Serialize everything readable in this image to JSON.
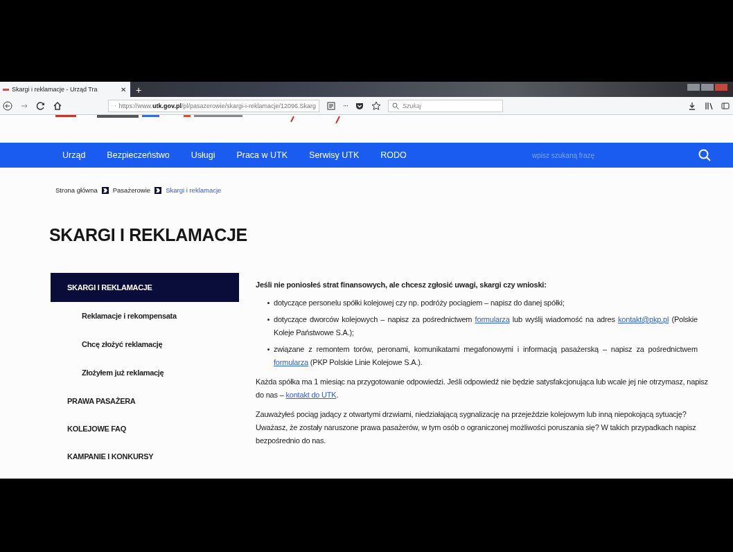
{
  "browser": {
    "tab": {
      "title": "Skargi i reklamacje - Urząd Tra",
      "close": "✕"
    },
    "new_tab": "+",
    "address": "https://www.**utk.gov.pl**/pl/pasazerowie/skargi-i-reklamacje/12096.Skarg",
    "more": "···",
    "search": {
      "placeholder": "Szukaj"
    }
  },
  "nav": {
    "items": [
      {
        "label": "Urząd"
      },
      {
        "label": "Bezpieczeństwo"
      },
      {
        "label": "Usługi"
      },
      {
        "label": "Praca w UTK"
      },
      {
        "label": "Serwisy UTK"
      },
      {
        "label": "RODO"
      }
    ],
    "search": {
      "placeholder": "wpisz szukaną frazę"
    }
  },
  "breadcrumb": [
    {
      "label": "Strona główna",
      "current": false
    },
    {
      "label": "Pasażerowie",
      "current": false
    },
    {
      "label": "Skargi i reklamacje",
      "current": true
    }
  ],
  "title": "SKARGI I REKLAMACJE",
  "sidebar": [
    {
      "label": "SKARGI I REKLAMACJE",
      "selected": true,
      "children": [
        {
          "label": "Reklamacje i rekompensata",
          "selected": false
        },
        {
          "label": "Chcę złożyć reklamację",
          "selected": false
        },
        {
          "label": "Złożyłem już reklamację",
          "selected": false
        }
      ]
    },
    {
      "label": "PRAWA PASAŻERA",
      "selected": false
    },
    {
      "label": "KOLEJOWE FAQ",
      "selected": false
    },
    {
      "label": "KAMPANIE I KONKURSY",
      "selected": false
    }
  ],
  "content": {
    "lead": "Jeśli nie poniosłeś strat finansowych, ale chcesz zgłosić uwagi, skargi czy wnioski:",
    "bullets": [
      [
        {
          "text": "dotyczące personelu spółki kolejowej czy np. podróży pociągiem – napisz do danej spółki;"
        }
      ],
      [
        {
          "text": "dotyczące dworców kolejowych – napisz za pośrednictwem "
        },
        {
          "text": "formularza",
          "kind": "link"
        },
        {
          "text": " lub wyślij wiadomość na adres "
        },
        {
          "text": "kontakt@pkp.pl",
          "kind": "link"
        },
        {
          "text": " (Polskie Koleje Państwowe S.A.);"
        }
      ],
      [
        {
          "text": "związane z remontem torów, peronami, komunikatami megafonowymi i informacją pasażerską – napisz za pośrednictwem "
        },
        {
          "text": "formularza",
          "kind": "link"
        },
        {
          "text": " (PKP Polskie Linie Kolejowe S.A.)."
        }
      ]
    ],
    "paragraphs": [
      [
        {
          "text": "Każda spółka ma 1 miesiąc na przygotowanie odpowiedzi. Jeśli odpowiedź nie będzie satysfakcjonująca lub wcale jej nie otrzymasz, napisz do nas – "
        },
        {
          "text": "kontakt do UTK",
          "kind": "link"
        },
        {
          "text": "."
        }
      ],
      [
        {
          "text": "Zauważyłeś pociąg jadący z otwartymi drzwiami, niedziałającą sygnalizację na przejeździe kolejowym lub inną niepokojącą sytuację? Uważasz, że zostały naruszone prawa pasażerów, w tym osób o ograniczonej możliwości poruszania się? W takich przypadkach napisz bezpośrednio do nas."
        }
      ]
    ]
  }
}
